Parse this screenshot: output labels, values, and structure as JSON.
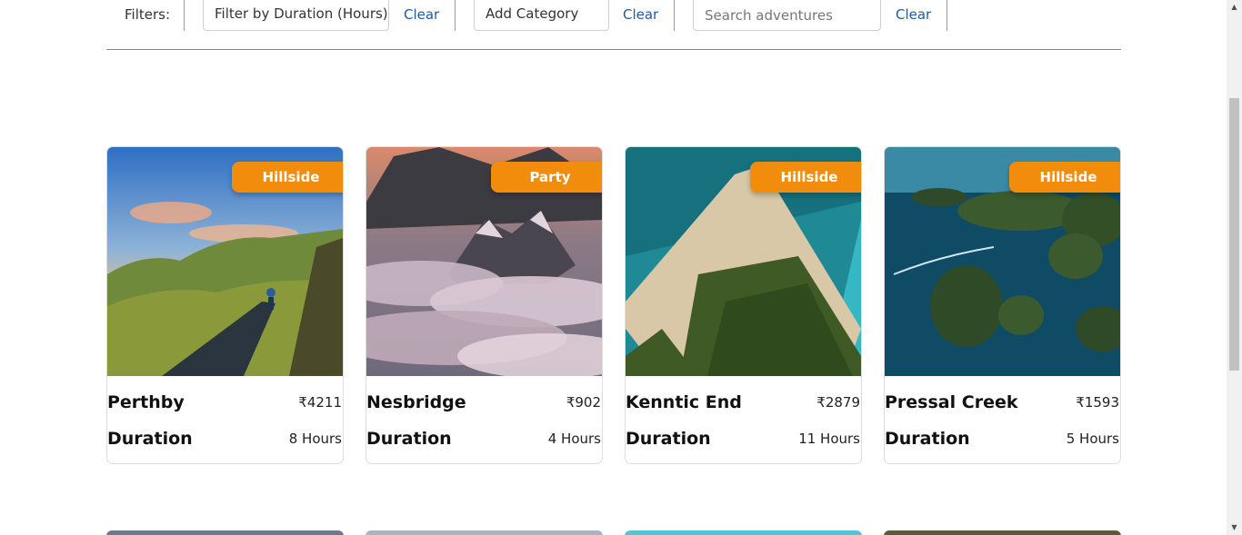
{
  "filters": {
    "label": "Filters:",
    "duration_value": "Filter by Duration (Hours)",
    "category_value": "Add Category",
    "search_placeholder": "Search adventures",
    "clear_label": "Clear"
  },
  "cards": [
    {
      "name": "Perthby",
      "price": "₹4211",
      "duration_label": "Duration",
      "duration": "8 Hours",
      "category": "Hillside",
      "image": "road-through-hills"
    },
    {
      "name": "Nesbridge",
      "price": "₹902",
      "duration_label": "Duration",
      "duration": "4 Hours",
      "category": "Party",
      "image": "mountains-above-clouds"
    },
    {
      "name": "Kenntic End",
      "price": "₹2879",
      "duration_label": "Duration",
      "duration": "11 Hours",
      "category": "Hillside",
      "image": "beach-spit-aerial"
    },
    {
      "name": "Pressal Creek",
      "price": "₹1593",
      "duration_label": "Duration",
      "duration": "5 Hours",
      "category": "Hillside",
      "image": "island-lagoon-aerial"
    }
  ],
  "colors": {
    "badge": "#f28c0c",
    "link": "#1f5aa6"
  }
}
